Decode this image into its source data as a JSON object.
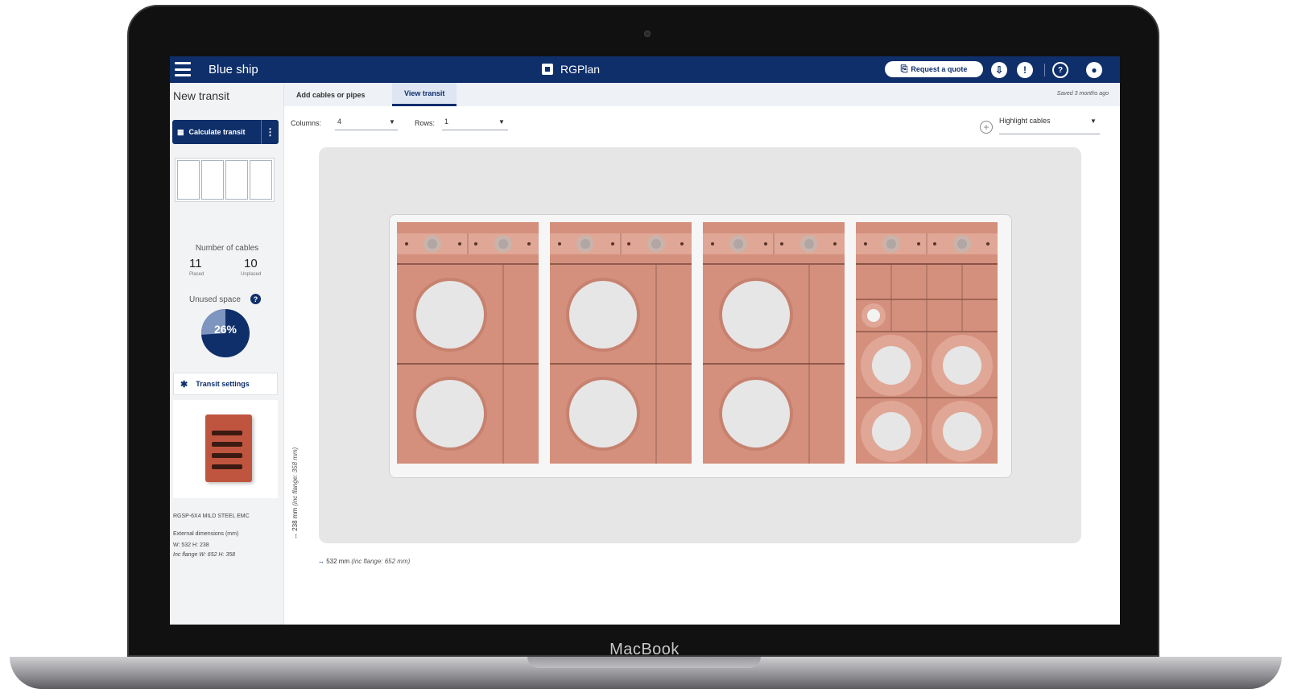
{
  "device": {
    "brand": "MacBook"
  },
  "header": {
    "app_name": "Blue ship",
    "product_name": "RGPlan",
    "quote_button": "Request a quote",
    "icons": [
      "menu-icon",
      "download-icon",
      "info-icon",
      "help-icon",
      "user-icon"
    ]
  },
  "sidebar": {
    "title": "New transit",
    "calculate_button": "Calculate transit",
    "cables_label": "Number of cables",
    "placed_count": "11",
    "placed_label": "Placed",
    "unplaced_count": "10",
    "unplaced_label": "Unplaced",
    "unused_label": "Unused space",
    "unused_percent": "26%",
    "unused_fraction": 0.26,
    "settings_button": "Transit settings",
    "product_code": "RGSP-6X4 MILD STEEL EMC",
    "external_dimensions_label": "External dimensions (mm)",
    "external_dimensions": "W: 532 H: 238",
    "flange_dimensions": "Inc flange W: 652 H: 358"
  },
  "tabs": [
    {
      "label": "Add cables or pipes",
      "active": false
    },
    {
      "label": "View transit",
      "active": true
    }
  ],
  "saved_text": "Saved 3 months ago",
  "controls": {
    "columns_label": "Columns:",
    "columns_value": "4",
    "rows_label": "Rows:",
    "rows_value": "1",
    "highlight_label": "Highlight cables"
  },
  "dimensions": {
    "height": "238 mm",
    "height_flange": "(inc flange: 358 mm)",
    "width": "532 mm",
    "width_flange": "(inc flange: 652 mm)"
  },
  "colors": {
    "primary": "#0f2f6b",
    "module_fill": "#d4907c",
    "module_stripe": "#e0a796",
    "cable_hole": "#e6e6e6",
    "canvas_bg": "#e6e6e6"
  },
  "transit": {
    "columns": 4,
    "rows": 1
  }
}
